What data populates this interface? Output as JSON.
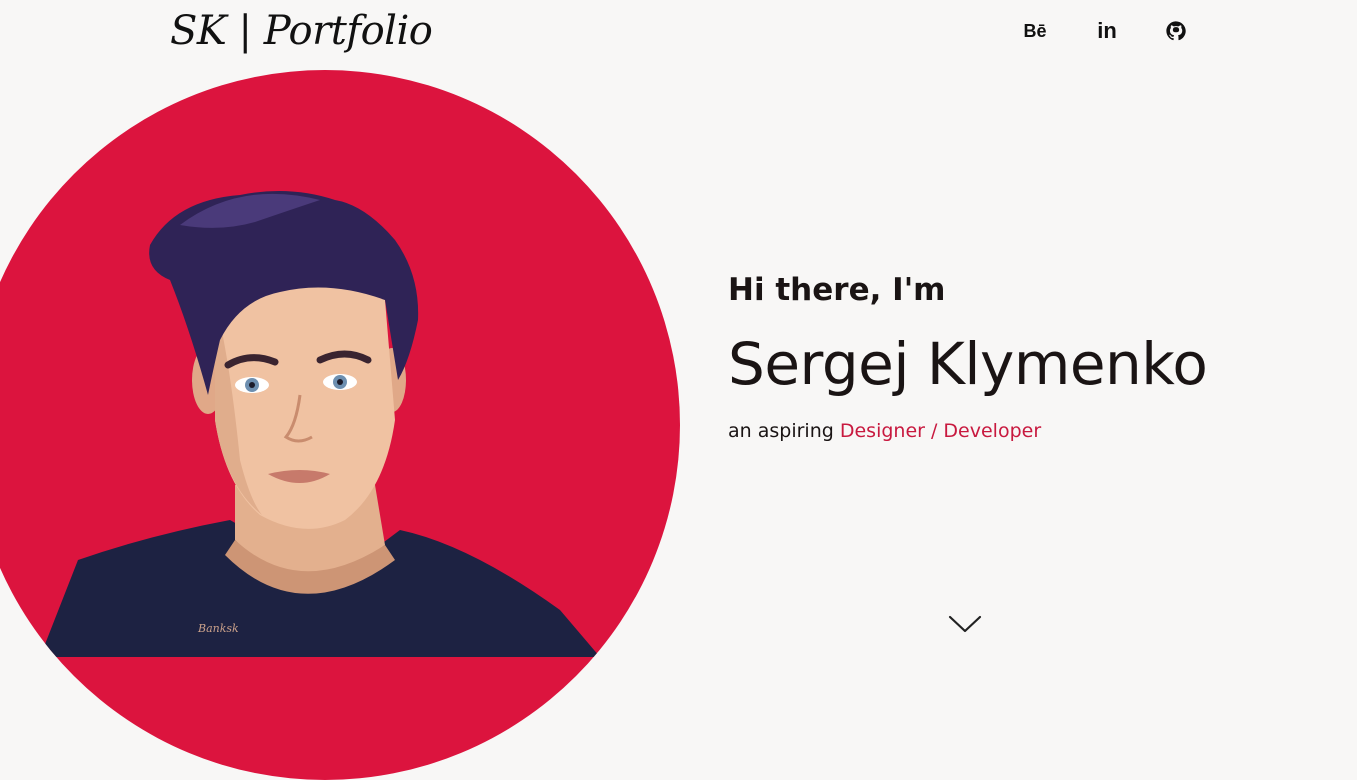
{
  "header": {
    "logo": "SK | Portfolio",
    "social": {
      "behance_label": "Bē",
      "linkedin_label": "in",
      "github_icon": "github-icon"
    }
  },
  "hero": {
    "greeting": "Hi there, I'm",
    "name": "Sergej Klymenko",
    "tagline_prefix": "an aspiring ",
    "tagline_accent": "Designer / Developer",
    "portrait_signature": "Banksk"
  },
  "colors": {
    "accent": "#dc143e",
    "text": "#1a1414",
    "background": "#f8f7f6",
    "hair": "#2f2356",
    "shirt": "#1d2242"
  },
  "icons": {
    "scroll": "chevron-down-icon"
  }
}
